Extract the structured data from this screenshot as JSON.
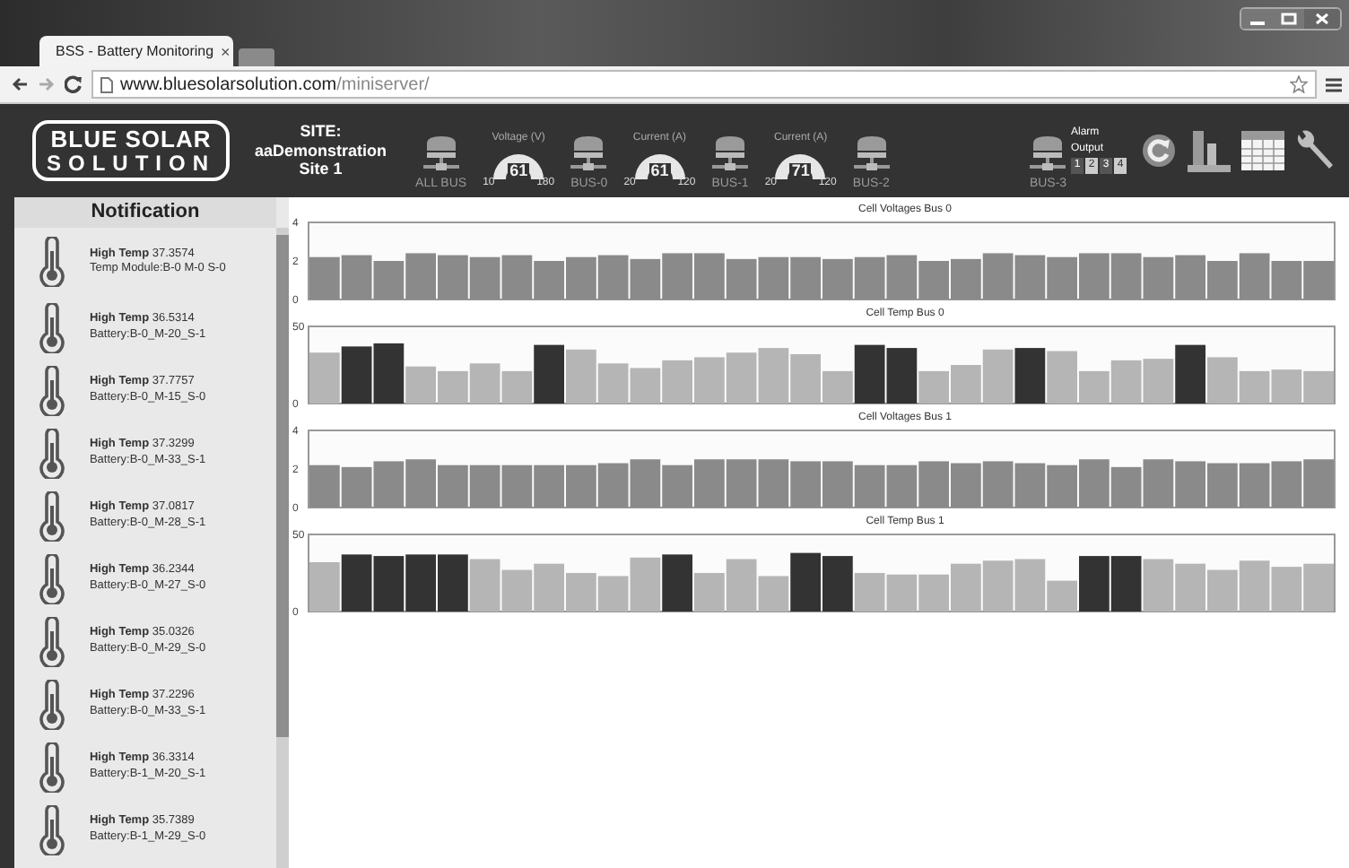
{
  "browser": {
    "tab": {
      "title": "BSS - Battery Monitoring",
      "close": "×"
    },
    "address": {
      "domain": "www.bluesolarsolution.com",
      "path": "/miniserver/"
    }
  },
  "header": {
    "logo": [
      "BLUE SOLAR",
      "SOLUTION"
    ],
    "site": [
      "SITE:",
      "aaDemonstration",
      "Site 1"
    ],
    "devices": [
      {
        "kind": "bus",
        "label": "ALL BUS"
      },
      {
        "kind": "gauge",
        "title": "Voltage (V)",
        "value": "61",
        "min": "10",
        "max": "180"
      },
      {
        "kind": "bus",
        "label": "BUS-0"
      },
      {
        "kind": "gauge",
        "title": "Current (A)",
        "value": "61",
        "min": "20",
        "max": "120"
      },
      {
        "kind": "bus",
        "label": "BUS-1"
      },
      {
        "kind": "gauge",
        "title": "Current (A)",
        "value": "71",
        "min": "20",
        "max": "120"
      },
      {
        "kind": "bus",
        "label": "BUS-2"
      }
    ],
    "standby_devices": [
      {
        "kind": "bus",
        "label": "BUS-3"
      }
    ],
    "alarm": {
      "label": [
        "Alarm",
        "Output"
      ],
      "outputs": [
        {
          "label": "1",
          "on": true
        },
        {
          "label": "2",
          "on": false
        },
        {
          "label": "3",
          "on": true
        },
        {
          "label": "4",
          "on": false
        }
      ]
    }
  },
  "notifications": {
    "title": "Notification",
    "items": [
      {
        "text": "**High Temp** 37.3574",
        "detail": "Temp Module:B-0 M-0 S-0"
      },
      {
        "text": "**High Temp** 36.5314",
        "detail": "Battery:B-0_M-20_S-1"
      },
      {
        "text": "**High Temp** 37.7757",
        "detail": "Battery:B-0_M-15_S-0"
      },
      {
        "text": "**High Temp** 37.3299",
        "detail": "Battery:B-0_M-33_S-1"
      },
      {
        "text": "**High Temp** 37.0817",
        "detail": "Battery:B-0_M-28_S-1"
      },
      {
        "text": "**High Temp** 36.2344",
        "detail": "Battery:B-0_M-27_S-0"
      },
      {
        "text": "**High Temp** 35.0326",
        "detail": "Battery:B-0_M-29_S-0"
      },
      {
        "text": "**High Temp** 37.2296",
        "detail": "Battery:B-0_M-33_S-1"
      },
      {
        "text": "**High Temp** 36.3314",
        "detail": "Battery:B-1_M-20_S-1"
      },
      {
        "text": "**High Temp** 35.7389",
        "detail": "Battery:B-1_M-29_S-0"
      }
    ]
  },
  "charts": [
    {
      "chart_data": {
        "type": "bar",
        "title": "Cell Voltages Bus 0",
        "ylim": [
          0,
          4
        ],
        "yticks": [
          0,
          2,
          4
        ],
        "stacked": true,
        "series": [
          {
            "color": "#8a8a8a",
            "values": [
              2.2,
              2.3,
              2.0,
              2.4,
              2.3,
              2.2,
              2.3,
              2.0,
              2.2,
              2.3,
              2.1,
              2.4,
              2.4,
              2.1,
              2.2,
              2.2,
              2.1,
              2.2,
              2.3,
              2.0,
              2.1,
              2.4,
              2.3,
              2.2,
              2.4,
              2.4,
              2.2,
              2.3,
              2.0,
              2.4,
              2.0,
              2.0
            ]
          }
        ]
      }
    },
    {
      "chart_data": {
        "type": "bar",
        "title": "Cell Temp Bus 0",
        "ylim": [
          0,
          50
        ],
        "yticks": [
          0,
          50
        ],
        "stacked": true,
        "series": [
          {
            "color": "#b5b5b5",
            "values": [
              33,
              null,
              null,
              24,
              21,
              26,
              21,
              null,
              35,
              26,
              23,
              28,
              30,
              33,
              36,
              32,
              21,
              null,
              null,
              21,
              25,
              35,
              null,
              34,
              21,
              28,
              29,
              null,
              30,
              21,
              22,
              21
            ]
          },
          {
            "color": "#333333",
            "values": [
              null,
              37,
              39,
              null,
              null,
              null,
              null,
              38,
              null,
              null,
              null,
              null,
              null,
              null,
              null,
              null,
              null,
              38,
              36,
              null,
              null,
              null,
              36,
              null,
              null,
              null,
              null,
              38,
              null,
              null,
              null,
              null
            ]
          }
        ]
      }
    },
    {
      "chart_data": {
        "type": "bar",
        "title": "Cell Voltages Bus 1",
        "ylim": [
          0,
          4
        ],
        "yticks": [
          0,
          2,
          4
        ],
        "stacked": true,
        "series": [
          {
            "color": "#8a8a8a",
            "values": [
              2.2,
              2.1,
              2.4,
              2.5,
              2.2,
              2.2,
              2.2,
              2.2,
              2.2,
              2.3,
              2.5,
              2.2,
              2.5,
              2.5,
              2.5,
              2.4,
              2.4,
              2.2,
              2.2,
              2.4,
              2.3,
              2.4,
              2.3,
              2.2,
              2.5,
              2.1,
              2.5,
              2.4,
              2.3,
              2.3,
              2.4,
              2.5
            ]
          }
        ]
      }
    },
    {
      "chart_data": {
        "type": "bar",
        "title": "Cell Temp Bus 1",
        "ylim": [
          0,
          50
        ],
        "yticks": [
          0,
          50
        ],
        "stacked": true,
        "series": [
          {
            "color": "#b5b5b5",
            "values": [
              32,
              null,
              null,
              null,
              null,
              34,
              27,
              31,
              25,
              23,
              35,
              null,
              25,
              34,
              23,
              null,
              null,
              25,
              24,
              24,
              31,
              33,
              34,
              20,
              null,
              null,
              34,
              31,
              27,
              33,
              29,
              31
            ]
          },
          {
            "color": "#333333",
            "values": [
              null,
              37,
              36,
              37,
              37,
              null,
              null,
              null,
              null,
              null,
              null,
              37,
              null,
              null,
              null,
              38,
              36,
              null,
              null,
              null,
              null,
              null,
              null,
              null,
              36,
              36,
              null,
              null,
              null,
              null,
              null,
              null
            ]
          }
        ]
      }
    }
  ]
}
